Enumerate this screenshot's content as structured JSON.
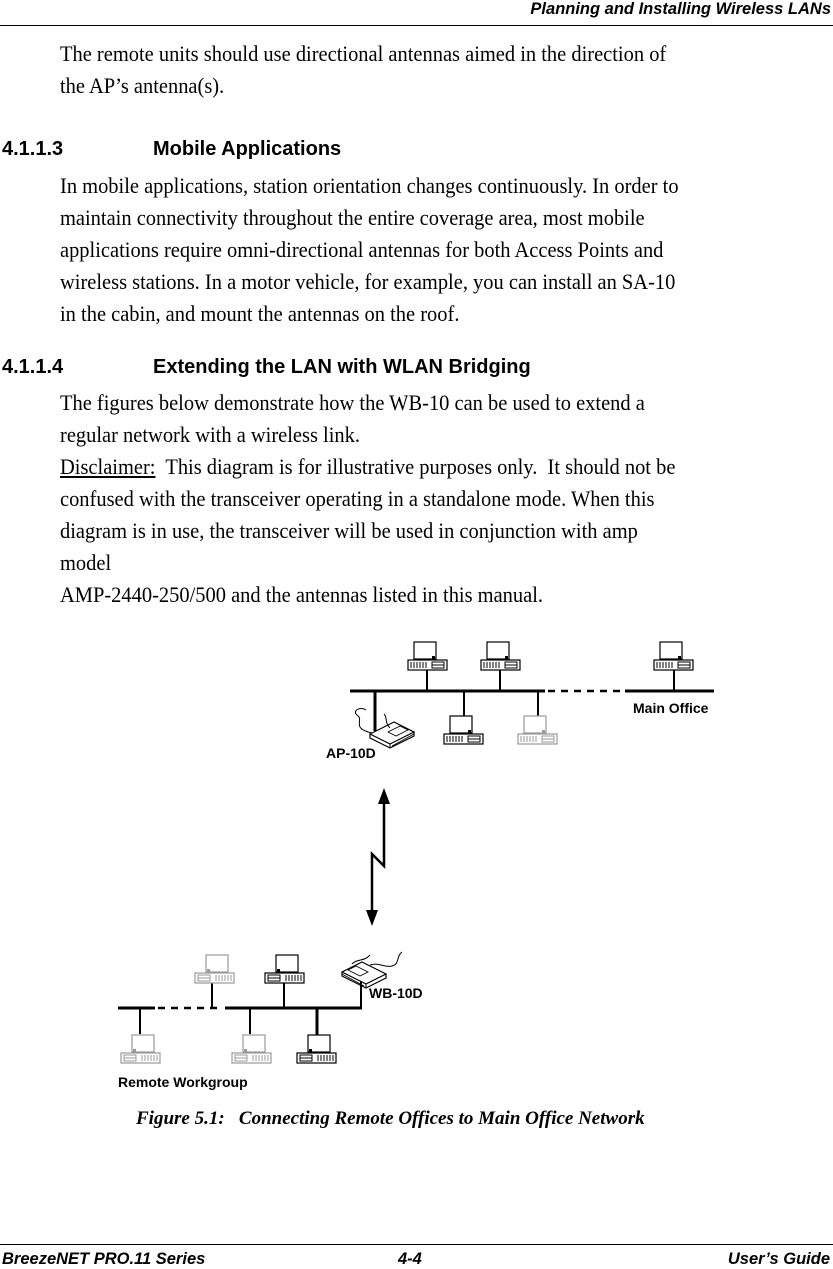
{
  "header": {
    "title": "Planning and Installing Wireless LANs"
  },
  "intro_paragraph": [
    "The remote units should use directional antennas aimed in the direction of",
    "the AP’s antenna(s)."
  ],
  "sections": [
    {
      "number": "4.1.1.3",
      "title": "Mobile Applications",
      "lines": [
        "In mobile applications, station orientation changes continuously. In order to",
        "maintain connectivity throughout the entire coverage area, most mobile",
        "applications require omni-directional antennas for both Access Points and",
        "wireless stations. In a motor vehicle, for example, you can install an SA-10",
        "in the cabin, and mount the antennas on the roof."
      ]
    },
    {
      "number": "4.1.1.4",
      "title": "Extending the LAN with WLAN Bridging",
      "lines": [
        "The figures below demonstrate how the WB-10 can be used to extend a",
        "regular network with a wireless link."
      ]
    }
  ],
  "disclaimer": {
    "label": "Disclaimer:",
    "first_line_rest": "  This diagram is for illustrative purposes only.  It should not be",
    "lines": [
      "confused with the transceiver operating in a standalone mode.  When this",
      "diagram is in use, the transceiver will be used in conjunction with amp",
      "model",
      "AMP-2440-250/500 and the antennas listed in this manual."
    ]
  },
  "diagram": {
    "main_office_label": "Main Office",
    "access_point_label": "AP-10D",
    "bridge_label": "WB-10D",
    "remote_workgroup_label": "Remote Workgroup",
    "link_type": "wireless-link"
  },
  "figure_caption": "Figure 5.1:   Connecting Remote Offices to Main Office Network",
  "footer": {
    "left": "BreezeNET PRO.11 Series",
    "center": "4-4",
    "right": "User’s Guide"
  }
}
